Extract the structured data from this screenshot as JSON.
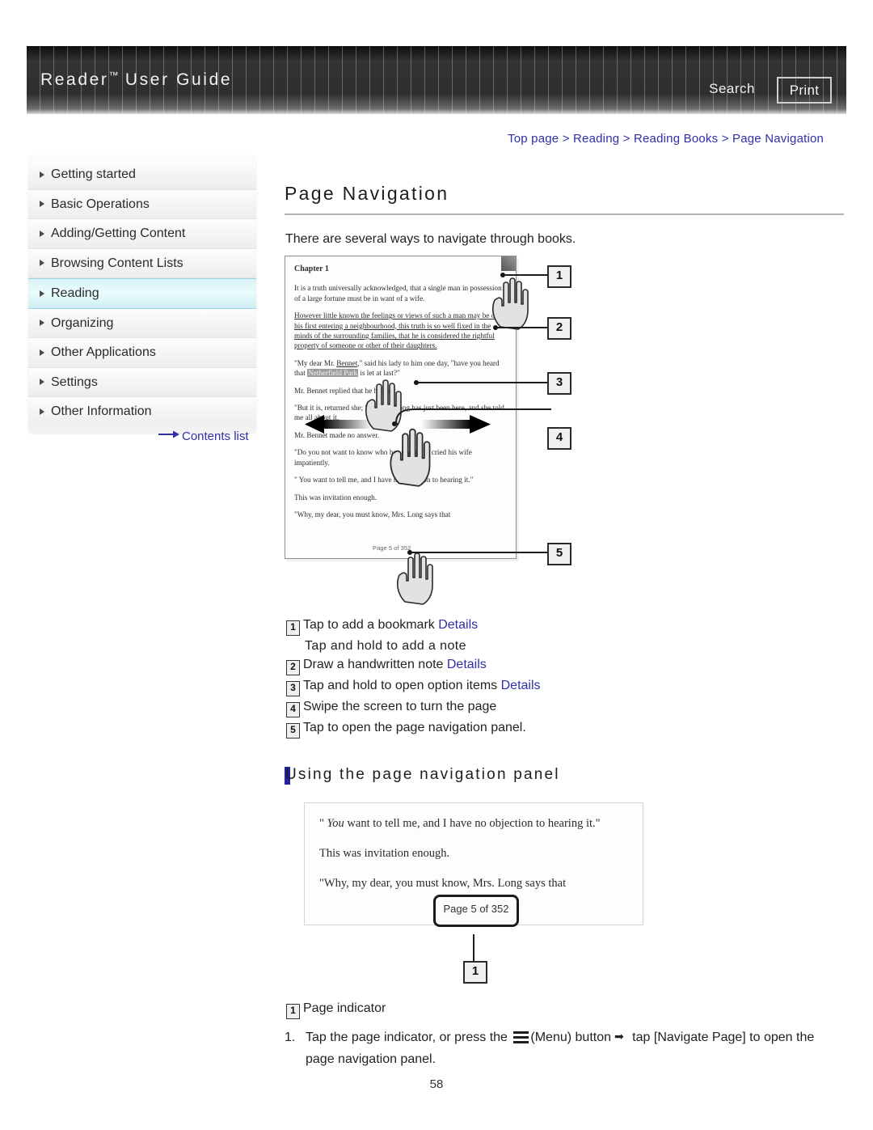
{
  "header": {
    "title_main": "Reader",
    "title_tm": "™",
    "title_rest": " User Guide",
    "search_label": "Search",
    "print_label": "Print"
  },
  "breadcrumb": {
    "text": "Top page > Reading > Reading Books > Page Navigation"
  },
  "sidebar": {
    "items": [
      {
        "label": "Getting started",
        "active": false
      },
      {
        "label": "Basic Operations",
        "active": false
      },
      {
        "label": "Adding/Getting Content",
        "active": false
      },
      {
        "label": "Browsing Content Lists",
        "active": false
      },
      {
        "label": "Reading",
        "active": true
      },
      {
        "label": "Organizing",
        "active": false
      },
      {
        "label": "Other Applications",
        "active": false
      },
      {
        "label": "Settings",
        "active": false
      },
      {
        "label": "Other Information",
        "active": false
      }
    ],
    "contents_link": "Contents list"
  },
  "main": {
    "page_title": "Page Navigation",
    "intro": "There are several ways to navigate through books.",
    "subheading": "Using the page navigation panel",
    "page_number": "58"
  },
  "device_figure": {
    "chapter": "Chapter 1",
    "paragraphs": [
      "It is a truth universally acknowledged, that a single man in possession of a large fortune must be in want of a wife.",
      "However little known the feelings or views of such a man may be on his first entering a neighbourhood, this truth is so well fixed in the minds of the surrounding families, that he is considered the rightful property of someone or other of their daughters.",
      "\"My dear Mr. Bennet,\" said his lady to him one day, \"have you heard that Netherfield Park is let at last?\"",
      "Mr. Bennet replied that he had not.",
      "\"But it is, returned she; \"for Mrs. Long has just been here, and she told me all about it.",
      "Mr. Bennet made no answer.",
      "\"Do you not want to know who has taken it?\" cried his wife impatiently.",
      "\" You want to tell me, and I have no objection to hearing it.\"",
      "This was invitation enough.",
      "\"Why, my dear, you must know, Mrs. Long says that"
    ],
    "highlighted_phrase": "Netherfield Park",
    "page_indicator": "Page 5 of 352",
    "callouts": [
      "1",
      "2",
      "3",
      "4",
      "5"
    ]
  },
  "legend": {
    "items": [
      {
        "num": "1",
        "text": "Tap to add a bookmark ",
        "link": "Details",
        "sub": "Tap and hold to add a note"
      },
      {
        "num": "2",
        "text": "Draw a handwritten note ",
        "link": "Details",
        "sub": ""
      },
      {
        "num": "3",
        "text": "Tap and hold to open option items ",
        "link": "Details",
        "sub": ""
      },
      {
        "num": "4",
        "text": "Swipe the screen to turn the page",
        "link": "",
        "sub": ""
      },
      {
        "num": "5",
        "text": "Tap to open the page navigation panel.",
        "link": "",
        "sub": ""
      }
    ]
  },
  "panel_figure": {
    "line1_italic": "You",
    "line1_rest": " want to tell me, and I have no objection to hearing it.\"",
    "line1_open": "\" ",
    "line2": "This was invitation enough.",
    "line3": "\"Why, my dear, you must know, Mrs. Long says that",
    "page_pill": "Page 5 of 352",
    "callout": "1"
  },
  "bottom": {
    "legend_num": "1",
    "legend_text": "Page indicator",
    "step_num": "1.",
    "step_part1": "Tap the page indicator, or press the ",
    "step_part2": "(Menu) button",
    "step_arrow": "➡",
    "step_part3": " tap [Navigate Page] to open the",
    "step_part4": "page navigation panel."
  },
  "colors": {
    "link": "#2f2fa8",
    "accent_bar": "#2222a0",
    "active_nav": "#d9f3f7",
    "header_dark": "#2e2e2e"
  }
}
